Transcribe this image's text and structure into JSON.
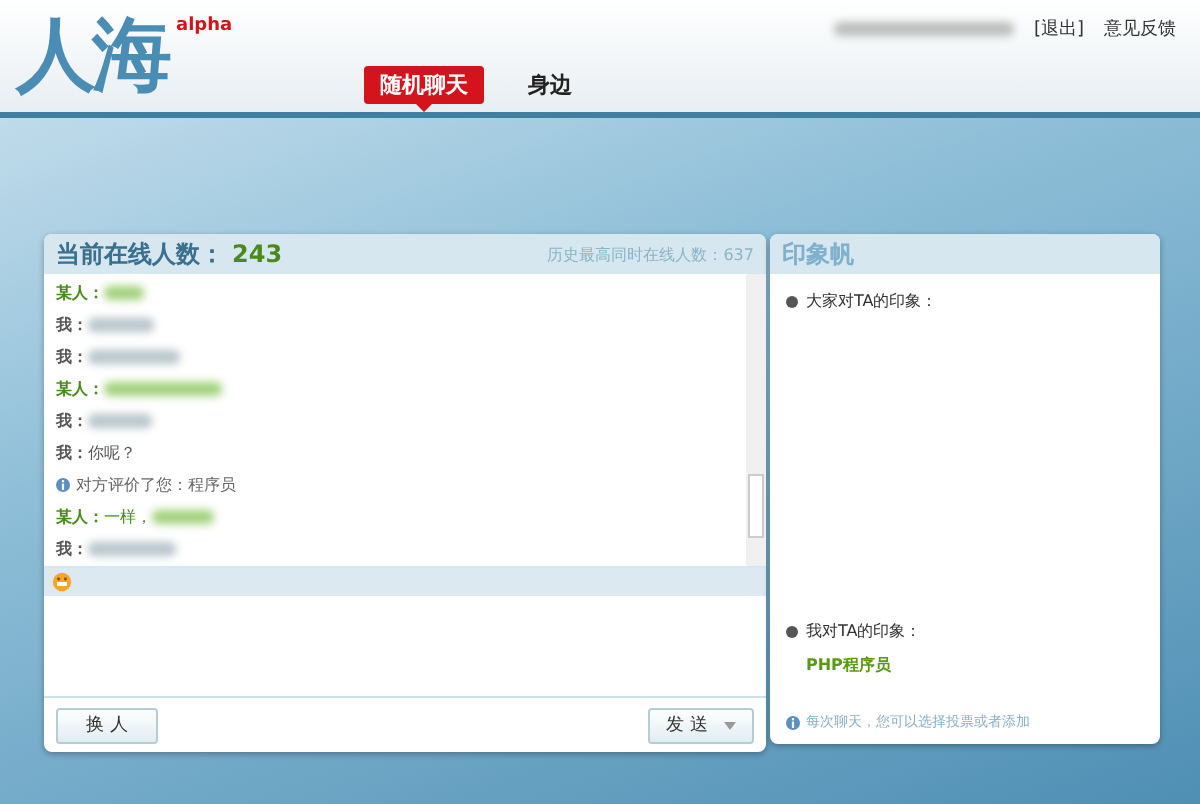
{
  "logo": {
    "name": "人海",
    "badge": "alpha"
  },
  "nav": [
    {
      "label": "随机聊天",
      "selected": true
    },
    {
      "label": "身边",
      "selected": false
    }
  ],
  "user_links": [
    "[退出]",
    "意见反馈"
  ],
  "chat": {
    "title": "当前在线人数：",
    "online": "243",
    "record": "历史最高同时在线人数：637",
    "messages": [
      {
        "kind": "them",
        "sender": "某人："
      },
      {
        "kind": "me",
        "sender": "我："
      },
      {
        "kind": "me",
        "sender": "我："
      },
      {
        "kind": "them",
        "sender": "某人："
      },
      {
        "kind": "me",
        "sender": "我："
      },
      {
        "kind": "me",
        "sender": "我：",
        "text": "你呢？"
      },
      {
        "kind": "notice",
        "text": "对方评价了您：程序员"
      },
      {
        "kind": "them",
        "sender": "某人：",
        "text": "一样，"
      },
      {
        "kind": "me",
        "sender": "我："
      }
    ],
    "buttons": {
      "switch": "换 人",
      "send": "发 送"
    }
  },
  "impressions": {
    "title": "印象帆",
    "sections": [
      {
        "label": "大家对TA的印象："
      },
      {
        "label": "我对TA的印象：",
        "tags": [
          "PHP程序员"
        ]
      }
    ],
    "note": "每次聊天，您可以选择投票或者添加"
  }
}
